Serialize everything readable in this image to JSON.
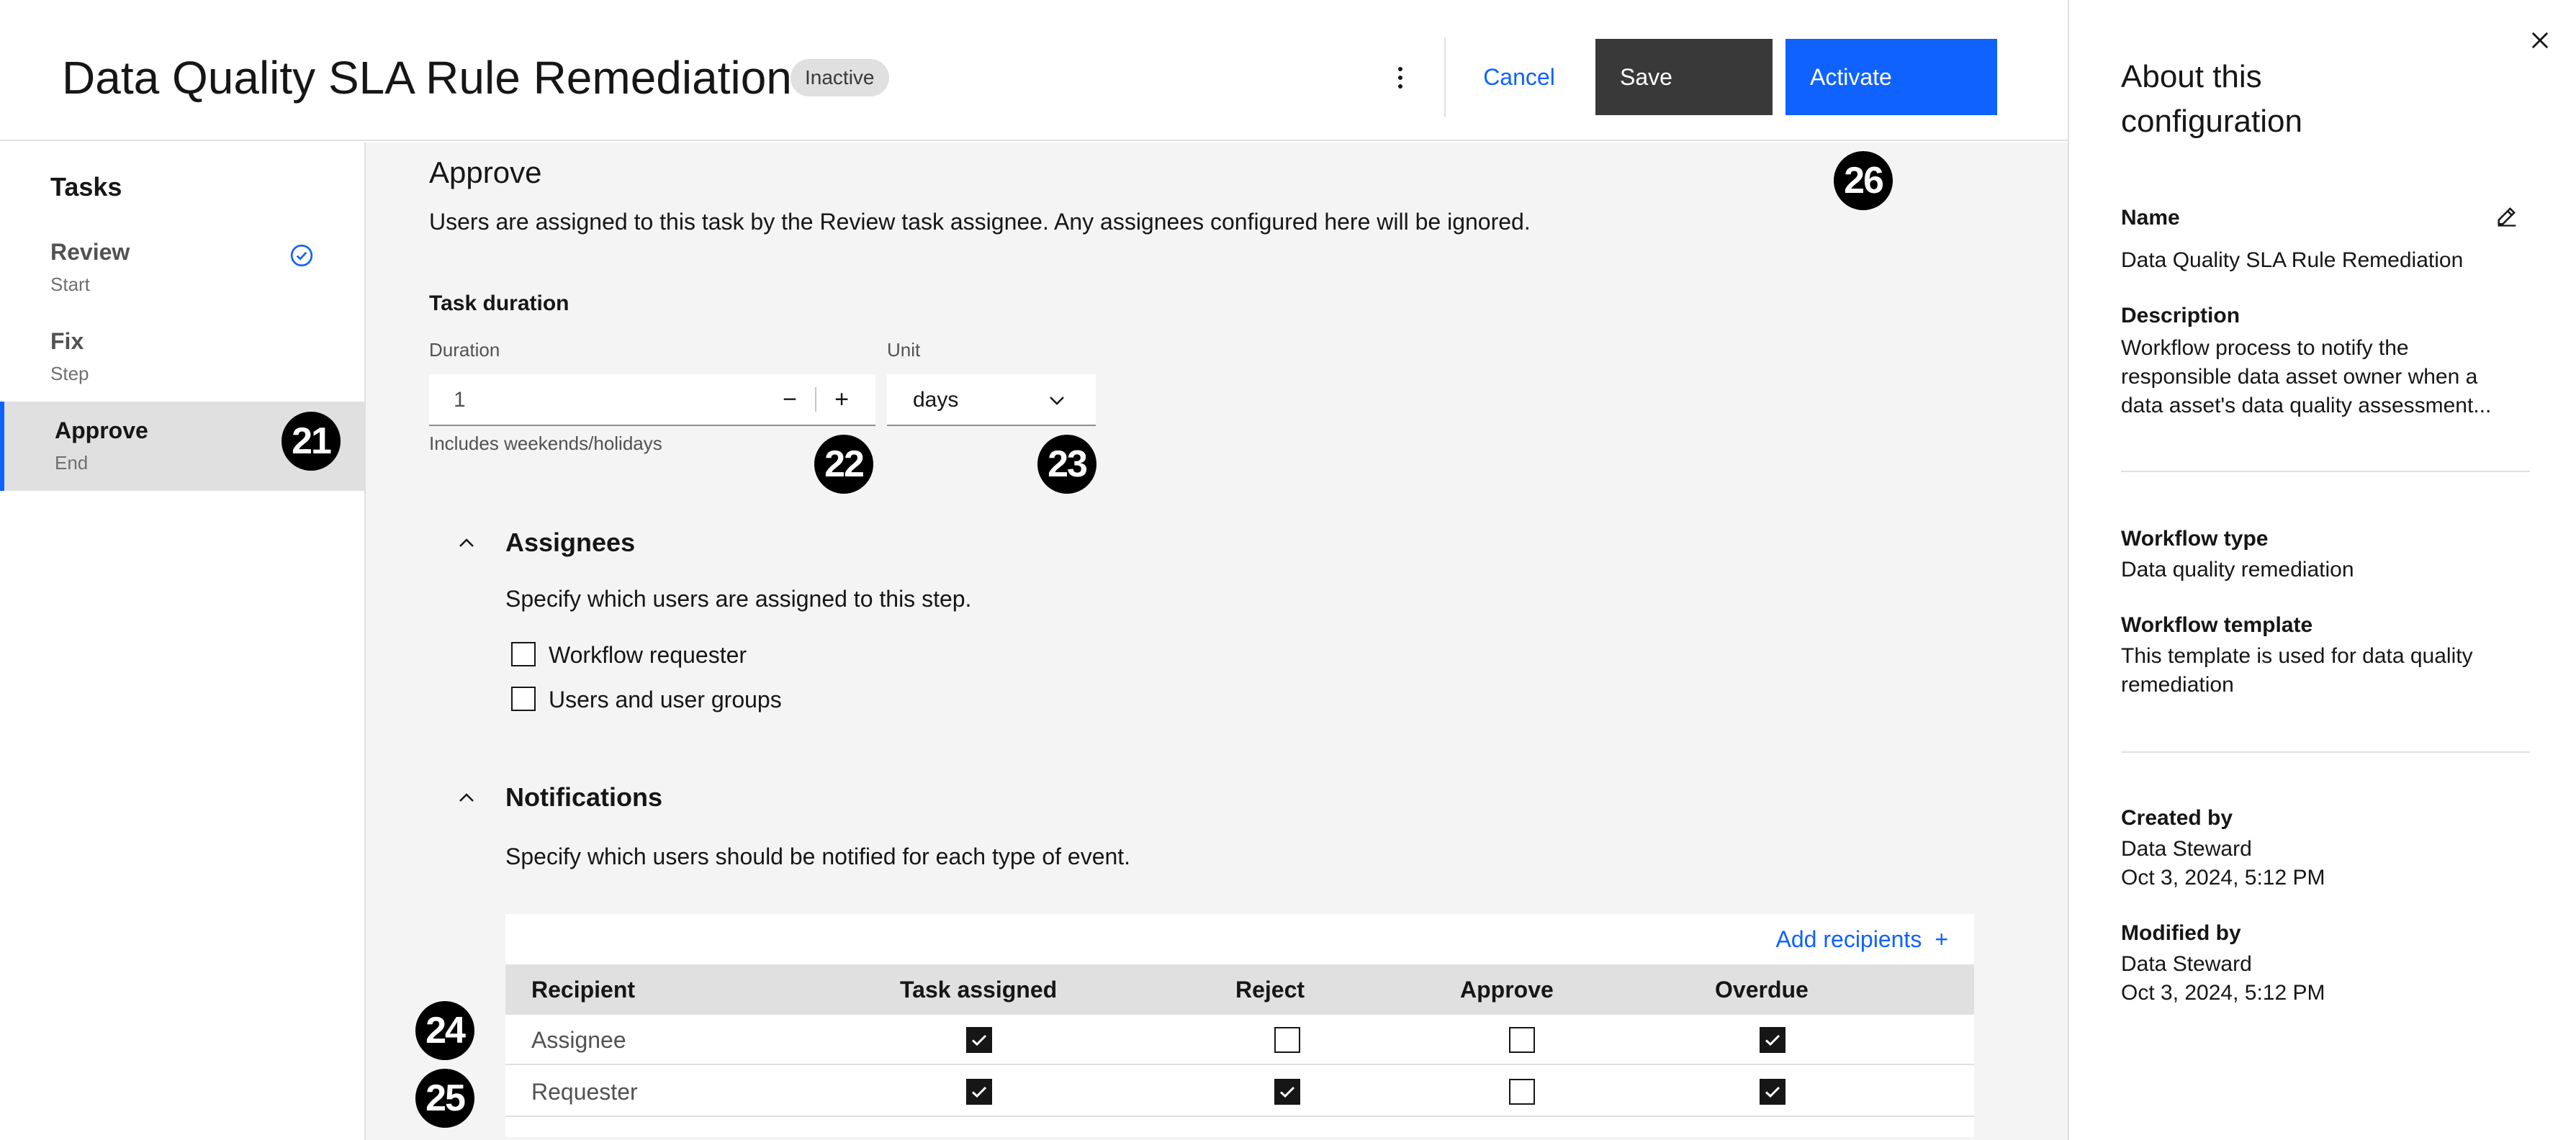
{
  "header": {
    "title": "Data Quality SLA Rule Remediation",
    "status": "Inactive",
    "cancel_label": "Cancel",
    "save_label": "Save",
    "activate_label": "Activate"
  },
  "sidebar": {
    "heading": "Tasks",
    "items": [
      {
        "label": "Review",
        "sub": "Start",
        "icon": "check-circle-icon"
      },
      {
        "label": "Fix",
        "sub": "Step"
      },
      {
        "label": "Approve",
        "sub": "End",
        "selected": true
      }
    ]
  },
  "main": {
    "title": "Approve",
    "description": "Users are assigned to this task by the Review task assignee. Any assignees configured here will be ignored.",
    "task_duration": {
      "heading": "Task duration",
      "duration_label": "Duration",
      "duration_value": "1",
      "decrement": "−",
      "increment": "+",
      "unit_label": "Unit",
      "unit_value": "days",
      "helper": "Includes weekends/holidays"
    },
    "assignees": {
      "title": "Assignees",
      "description": "Specify which users are assigned to this step.",
      "options": [
        "Workflow requester",
        "Users and user groups"
      ]
    },
    "notifications": {
      "title": "Notifications",
      "description": "Specify which users should be notified for each type of event.",
      "add_recipients": "Add recipients",
      "add_icon": "+",
      "columns": [
        "Recipient",
        "Task assigned",
        "Reject",
        "Approve",
        "Overdue"
      ],
      "rows": [
        {
          "recipient": "Assignee",
          "values": [
            true,
            false,
            false,
            true
          ]
        },
        {
          "recipient": "Requester",
          "values": [
            true,
            true,
            false,
            true
          ]
        }
      ]
    }
  },
  "markers": [
    "21",
    "22",
    "23",
    "24",
    "25",
    "26"
  ],
  "right_panel": {
    "title": "About this configuration",
    "name_label": "Name",
    "name_value": "Data Quality SLA Rule Remediation",
    "description_label": "Description",
    "description_value": "Workflow process to notify the responsible data asset owner when a data asset's data quality assessment...",
    "workflow_type_label": "Workflow type",
    "workflow_type_value": "Data quality remediation",
    "workflow_template_label": "Workflow template",
    "workflow_template_value": "This template is used for data quality remediation",
    "created_by_label": "Created by",
    "created_by_name": "Data Steward",
    "created_by_date": "Oct 3, 2024, 5:12 PM",
    "modified_by_label": "Modified by",
    "modified_by_name": "Data Steward",
    "modified_by_date": "Oct 3, 2024, 5:12 PM"
  },
  "colors": {
    "primary": "#0f62fe",
    "secondary_button": "#393939",
    "selected_nav_bg": "#e0e0e0",
    "content_bg": "#f4f4f4"
  }
}
